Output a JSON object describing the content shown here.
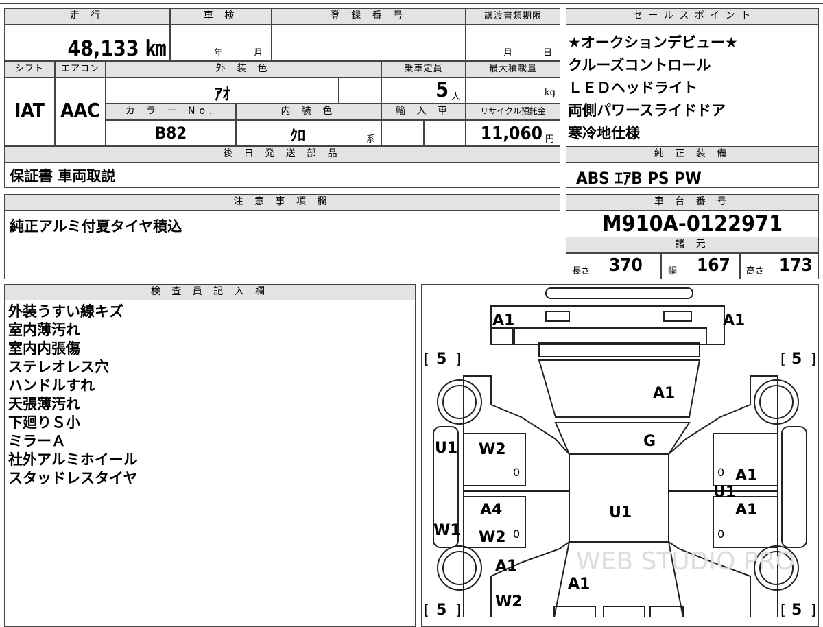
{
  "header": {
    "mileage_label": "走 行",
    "shaken_label": "車 検",
    "registration_label": "登 録 番 号",
    "transfer_label": "譲渡書類期限",
    "sales_label": "セ ー ル ス ポ イ ン ト"
  },
  "vehicle": {
    "mileage": "48,133 ㎞",
    "shaken_year_unit": "年",
    "shaken_month_unit": "月",
    "transfer_month_unit": "月",
    "transfer_day_unit": "日"
  },
  "row2": {
    "shift_label": "シフト",
    "ac_label": "エアコン",
    "exterior_label": "外 装 色",
    "capacity_label": "乗車定員",
    "maxload_label": "最大積載量",
    "shift": "IAT",
    "ac": "AAC",
    "exterior_color": "ｱｵ",
    "capacity": "5",
    "capacity_unit": "人",
    "maxload_unit": "kg",
    "color_no_label": "カ ラ ー No.",
    "interior_label": "内 装 色",
    "import_label": "輸 入 車",
    "recycle_label": "リサイクル預託金",
    "color_no": "B82",
    "interior": "ｸﾛ",
    "interior_unit": "系",
    "recycle": "11,060",
    "recycle_unit": "円"
  },
  "sales_points": [
    "★オークションデビュー★",
    "クルーズコントロール",
    "ＬＥＤヘッドライト",
    "両側パワースライドドア",
    "寒冷地仕様"
  ],
  "later_parts": {
    "label": "後 日 発 送 部 品",
    "value": "保証書 車両取説"
  },
  "genuine_equipment": {
    "label": "純 正 装 備",
    "value": "ABS ｴｱB PS PW"
  },
  "notes": {
    "label": "注 意 事 項 欄",
    "value": "純正アルミ付夏タイヤ積込"
  },
  "chassis": {
    "label": "車 台 番 号",
    "value": "M910A-0122971"
  },
  "specs": {
    "label": "諸 元",
    "length_label": "長さ",
    "length": "370",
    "width_label": "幅",
    "width": "167",
    "height_label": "高さ",
    "height": "173"
  },
  "inspector": {
    "label": "検 査 員 記 入 欄",
    "items": [
      "外装うすい線キズ",
      "室内薄汚れ",
      "室内内張傷",
      "ステレオレス穴",
      "ハンドルすれ",
      "天張薄汚れ",
      "下廻りＳ小",
      "ミラーＡ",
      "社外アルミホイール",
      "スタッドレスタイヤ"
    ]
  },
  "diagram": {
    "marks": {
      "front_left": "A1",
      "front_right": "A1",
      "hood": "A1",
      "windshield": "G",
      "front_door_left_1": "W2",
      "front_door_left_2": "U1",
      "rear_door_left_1": "A4",
      "rear_door_left_2": "W2",
      "left_side": "U1",
      "left_sill": "W1",
      "roof": "U1",
      "right_1": "A1",
      "right_2": "U1",
      "right_3": "A1",
      "rear_left_1": "A1",
      "rear_left_2": "W2",
      "rear_center": "A1",
      "tire_fl": "5",
      "tire_fr": "5",
      "tire_rl": "5",
      "tire_rr": "5",
      "zero1": "0",
      "zero2": "0",
      "zero3": "0",
      "zero4": "0"
    },
    "watermark": "WEB STUDIO PRO"
  }
}
